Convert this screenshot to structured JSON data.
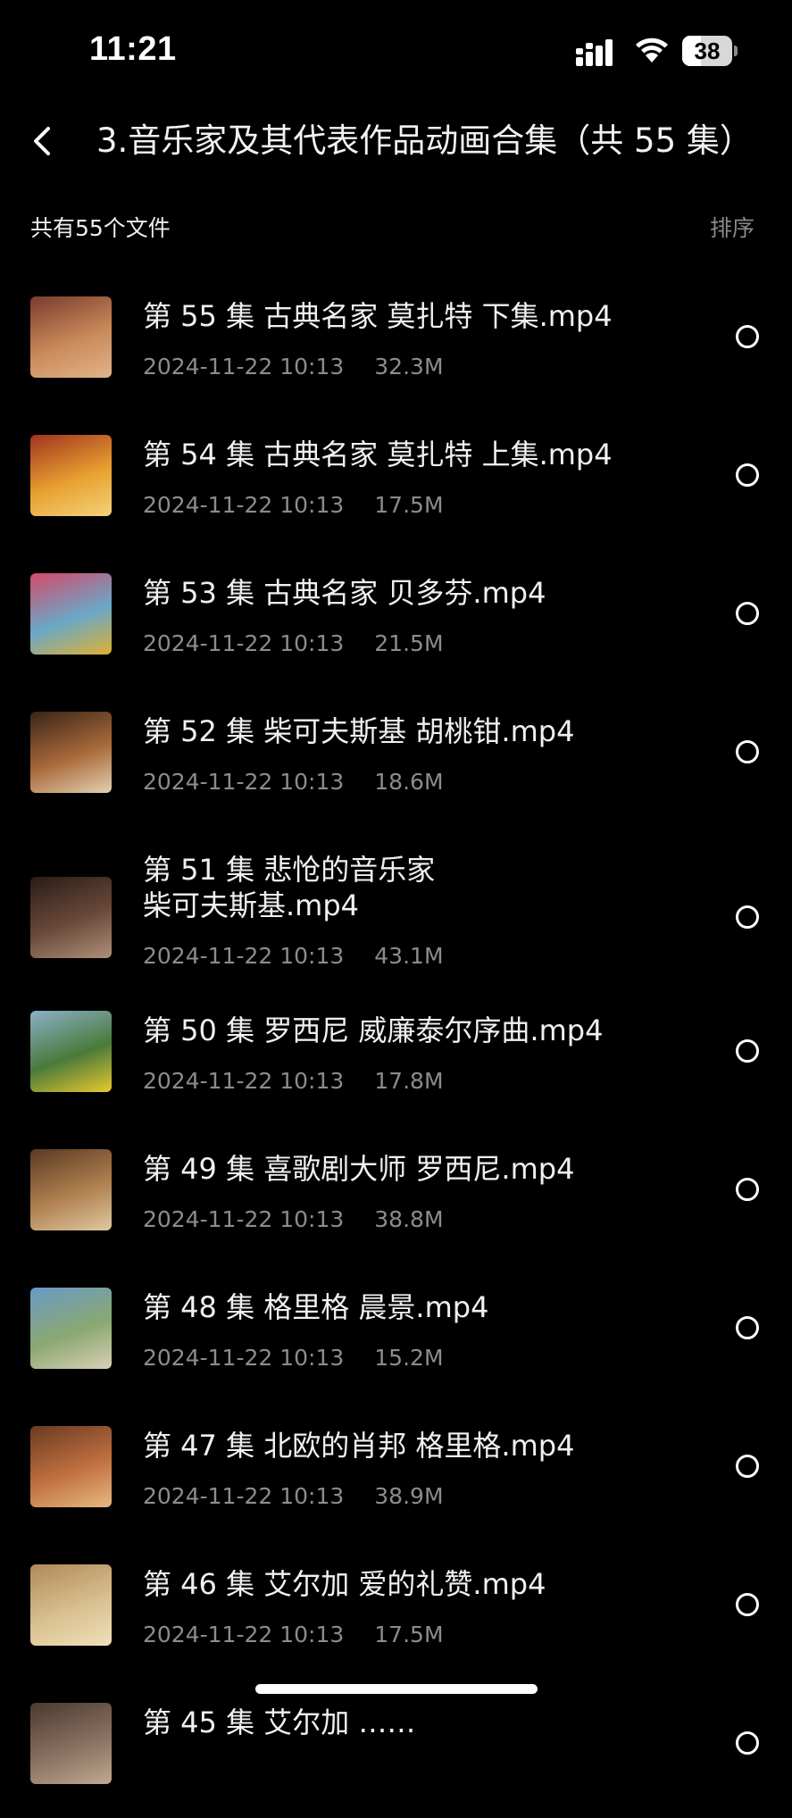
{
  "status_bar": {
    "time": "11:21",
    "battery_level": "38",
    "battery_fraction": 0.38
  },
  "header": {
    "back_icon": "chevron-left-icon",
    "title": "3.音乐家及其代表作品动画合集（共 55 集）"
  },
  "summary": {
    "file_count_label": "共有55个文件",
    "sort_label": "排序"
  },
  "files": [
    {
      "name": "第 55 集 古典名家 莫扎特 下集.mp4",
      "date": "2024-11-22 10:13",
      "size": "32.3M",
      "thumb_colors": [
        "#7a3b2e",
        "#c98a5a",
        "#e2b48a"
      ]
    },
    {
      "name": "第 54 集 古典名家 莫扎特 上集.mp4",
      "date": "2024-11-22 10:13",
      "size": "17.5M",
      "thumb_colors": [
        "#a0341f",
        "#e8a030",
        "#f4d27a"
      ]
    },
    {
      "name": "第 53 集 古典名家 贝多芬.mp4",
      "date": "2024-11-22 10:13",
      "size": "21.5M",
      "thumb_colors": [
        "#d44a6a",
        "#6aa8c8",
        "#e0b030"
      ]
    },
    {
      "name": "第 52 集 柴可夫斯基 胡桃钳.mp4",
      "date": "2024-11-22 10:13",
      "size": "18.6M",
      "thumb_colors": [
        "#3a2418",
        "#a86a3a",
        "#e4d0b0"
      ]
    },
    {
      "name": "第 51 集 悲怆的音乐家\n柴可夫斯基.mp4",
      "date": "2024-11-22 10:13",
      "size": "43.1M",
      "thumb_colors": [
        "#2a1c16",
        "#6a4a3a",
        "#b09078"
      ]
    },
    {
      "name": "第 50 集 罗西尼 威廉泰尔序曲.mp4",
      "date": "2024-11-22 10:13",
      "size": "17.8M",
      "thumb_colors": [
        "#8ab0c8",
        "#4a7a3a",
        "#e8c830"
      ]
    },
    {
      "name": "第 49 集 喜歌剧大师 罗西尼.mp4",
      "date": "2024-11-22 10:13",
      "size": "38.8M",
      "thumb_colors": [
        "#5a3a22",
        "#b08050",
        "#e0c8a0"
      ]
    },
    {
      "name": "第 48 集 格里格 晨景.mp4",
      "date": "2024-11-22 10:13",
      "size": "15.2M",
      "thumb_colors": [
        "#6a9ac8",
        "#8aa870",
        "#d8d0b8"
      ]
    },
    {
      "name": "第 47 集 北欧的肖邦 格里格.mp4",
      "date": "2024-11-22 10:13",
      "size": "38.9M",
      "thumb_colors": [
        "#6a3a22",
        "#c07040",
        "#e8b880"
      ]
    },
    {
      "name": "第 46 集 艾尔加 爱的礼赞.mp4",
      "date": "2024-11-22 10:13",
      "size": "17.5M",
      "thumb_colors": [
        "#b08a58",
        "#d8c090",
        "#f0e0b8"
      ]
    },
    {
      "name": "第 45 集 艾尔加 ……",
      "date": "",
      "size": "",
      "thumb_colors": [
        "#4a3a30",
        "#8a7060",
        "#c0a890"
      ]
    }
  ]
}
